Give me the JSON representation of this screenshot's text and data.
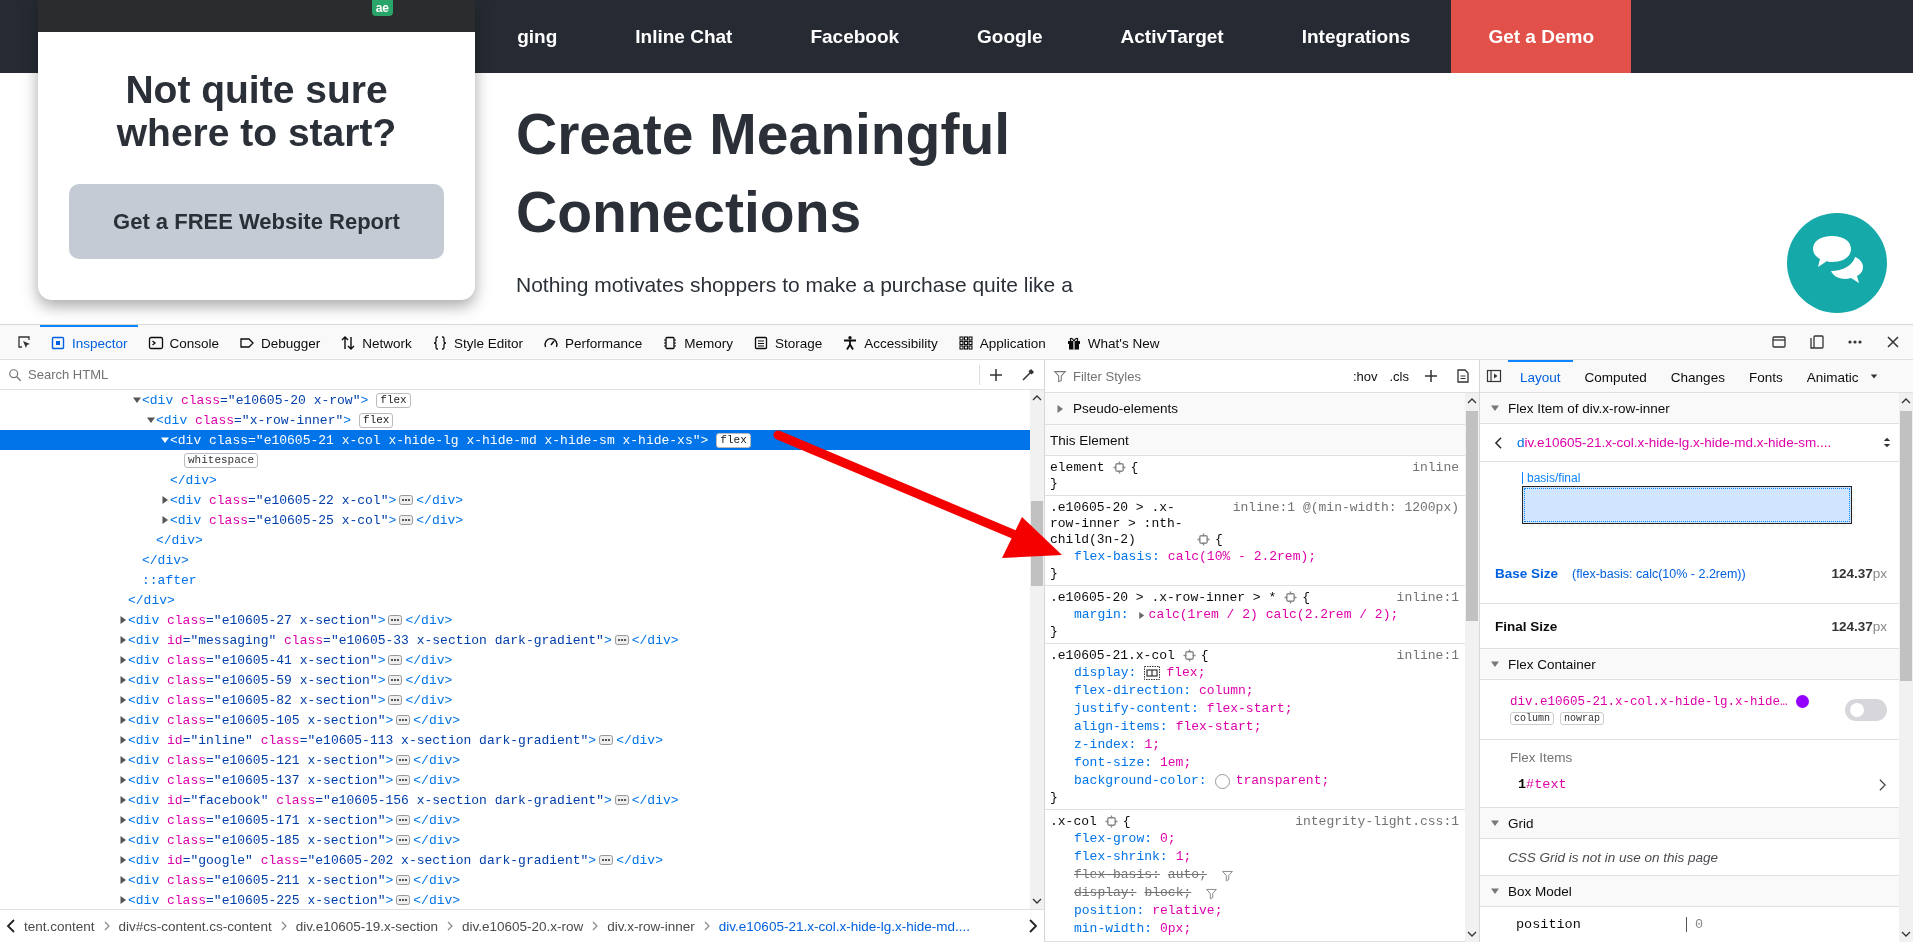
{
  "site": {
    "nav": [
      {
        "label": "ging"
      },
      {
        "label": "Inline Chat"
      },
      {
        "label": "Facebook"
      },
      {
        "label": "Google"
      },
      {
        "label": "ActivTarget"
      },
      {
        "label": "Integrations"
      }
    ],
    "demo_button": "Get a Demo",
    "popup": {
      "logo": "ae",
      "heading": "Not quite sure where to start?",
      "button": "Get a FREE Website Report"
    },
    "heading": "Create Meaningful Connections",
    "paragraph": "Nothing motivates shoppers to make a purchase quite like a"
  },
  "devtools": {
    "tabs": [
      {
        "label": "Inspector",
        "selected": true
      },
      {
        "label": "Console",
        "selected": false
      },
      {
        "label": "Debugger",
        "selected": false
      },
      {
        "label": "Network",
        "selected": false
      },
      {
        "label": "Style Editor",
        "selected": false
      },
      {
        "label": "Performance",
        "selected": false
      },
      {
        "label": "Memory",
        "selected": false
      },
      {
        "label": "Storage",
        "selected": false
      },
      {
        "label": "Accessibility",
        "selected": false
      },
      {
        "label": "Application",
        "selected": false
      },
      {
        "label": "What's New",
        "selected": false
      }
    ]
  },
  "inspector": {
    "search": {
      "placeholder": "Search HTML"
    },
    "tree": [
      {
        "kind": "element",
        "close": "</div>",
        "children": [
          {
            "kind": "element",
            "open": "<div class=\"e10605-20 x-row\">",
            "badge": "flex",
            "expanded": true,
            "selected": false,
            "close": "</div>",
            "children": [
              {
                "kind": "element",
                "open": "<div class=\"x-row-inner\">",
                "badge": "flex",
                "expanded": true,
                "selected": false,
                "close": "</div>",
                "children": [
                  {
                    "kind": "element",
                    "open": "<div class=\"e10605-21 x-col x-hide-lg x-hide-md x-hide-sm x-hide-xs\">",
                    "badge": "flex",
                    "expanded": true,
                    "selected": true,
                    "close": "</div>",
                    "children": [
                      {
                        "kind": "whitespace",
                        "badge": "whitespace"
                      }
                    ]
                  },
                  {
                    "kind": "element",
                    "open": "<div class=\"e10605-22 x-col\">",
                    "expanded": false,
                    "selected": false,
                    "close": "</div>"
                  },
                  {
                    "kind": "element",
                    "open": "<div class=\"e10605-25 x-col\">",
                    "expanded": false,
                    "selected": false,
                    "close": "</div>"
                  }
                ]
              }
            ]
          },
          {
            "kind": "pseudo",
            "open": "::after"
          }
        ]
      },
      {
        "kind": "element",
        "open": "<div class=\"e10605-27 x-section\">",
        "expanded": false,
        "selected": false,
        "close": "</div>"
      },
      {
        "kind": "element",
        "open": "<div id=\"messaging\" class=\"e10605-33 x-section dark-gradient\">",
        "expanded": false,
        "selected": false,
        "close": "</div>"
      },
      {
        "kind": "element",
        "open": "<div class=\"e10605-41 x-section\">",
        "expanded": false,
        "selected": false,
        "close": "</div>"
      },
      {
        "kind": "element",
        "open": "<div class=\"e10605-59 x-section\">",
        "expanded": false,
        "selected": false,
        "close": "</div>"
      },
      {
        "kind": "element",
        "open": "<div class=\"e10605-82 x-section\">",
        "expanded": false,
        "selected": false,
        "close": "</div>"
      },
      {
        "kind": "element",
        "open": "<div class=\"e10605-105 x-section\">",
        "expanded": false,
        "selected": false,
        "close": "</div>"
      },
      {
        "kind": "element",
        "open": "<div id=\"inline\" class=\"e10605-113 x-section dark-gradient\">",
        "expanded": false,
        "selected": false,
        "close": "</div>"
      },
      {
        "kind": "element",
        "open": "<div class=\"e10605-121 x-section\">",
        "expanded": false,
        "selected": false,
        "close": "</div>"
      },
      {
        "kind": "element",
        "open": "<div class=\"e10605-137 x-section\">",
        "expanded": false,
        "selected": false,
        "close": "</div>"
      },
      {
        "kind": "element",
        "open": "<div id=\"facebook\" class=\"e10605-156 x-section dark-gradient\">",
        "expanded": false,
        "selected": false,
        "close": "</div>"
      },
      {
        "kind": "element",
        "open": "<div class=\"e10605-171 x-section\">",
        "expanded": false,
        "selected": false,
        "close": "</div>"
      },
      {
        "kind": "element",
        "open": "<div class=\"e10605-185 x-section\">",
        "expanded": false,
        "selected": false,
        "close": "</div>"
      },
      {
        "kind": "element",
        "open": "<div id=\"google\" class=\"e10605-202 x-section dark-gradient\">",
        "expanded": false,
        "selected": false,
        "close": "</div>"
      },
      {
        "kind": "element",
        "open": "<div class=\"e10605-211 x-section\">",
        "expanded": false,
        "selected": false,
        "close": "</div>"
      },
      {
        "kind": "element",
        "open": "<div class=\"e10605-225 x-section\">",
        "expanded": false,
        "selected": false,
        "close": "</div>"
      }
    ],
    "breadcrumbs": [
      {
        "label": "tent.content",
        "selected": false
      },
      {
        "label": "div#cs-content.cs-content",
        "selected": false
      },
      {
        "label": "div.e10605-19.x-section",
        "selected": false
      },
      {
        "label": "div.e10605-20.x-row",
        "selected": false
      },
      {
        "label": "div.x-row-inner",
        "selected": false
      },
      {
        "label": "div.e10605-21.x-col.x-hide-lg.x-hide-md....",
        "selected": true
      }
    ]
  },
  "styles": {
    "filter": {
      "placeholder": "Filter Styles"
    },
    "hov": ":hov",
    "cls": ".cls",
    "pseudo": {
      "label": "Pseudo-elements",
      "expanded": false
    },
    "section": "This Element",
    "rules": [
      {
        "selector": "element",
        "source": "inline",
        "open": "{",
        "close": "}"
      },
      {
        "selector": ".e10605-20 > .x-row-inner > :nth-child(3n-2)",
        "source": "inline:1 @(min-width: 1200px)",
        "open": "{",
        "close": "}",
        "declarations": [
          {
            "property": "flex-basis:",
            "value": "calc(10% - 2.2rem);",
            "kind": "plain"
          }
        ]
      },
      {
        "selector": ".e10605-20 > .x-row-inner > *",
        "source": "inline:1",
        "open": "{",
        "close": "}",
        "declarations": [
          {
            "property": "margin:",
            "value": "calc(1rem / 2) calc(2.2rem / 2);",
            "kind": "shorthand"
          }
        ]
      },
      {
        "selector": ".e10605-21.x-col",
        "source": "inline:1",
        "open": "{",
        "close": "}",
        "declarations": [
          {
            "property": "display:",
            "value": "flex;",
            "kind": "display"
          },
          {
            "property": "flex-direction:",
            "value": "column;",
            "kind": "plain"
          },
          {
            "property": "justify-content:",
            "value": "flex-start;",
            "kind": "plain"
          },
          {
            "property": "align-items:",
            "value": "flex-start;",
            "kind": "plain"
          },
          {
            "property": "z-index:",
            "value": "1;",
            "kind": "plain"
          },
          {
            "property": "font-size:",
            "value": "1em;",
            "kind": "plain"
          },
          {
            "property": "background-color:",
            "value": "transparent;",
            "kind": "color"
          }
        ]
      },
      {
        "selector": ".x-col",
        "source": "integrity-light.css:1",
        "open": "{",
        "declarations": [
          {
            "property": "flex-grow:",
            "value": "0;",
            "kind": "plain"
          },
          {
            "property": "flex-shrink:",
            "value": "1;",
            "kind": "plain"
          },
          {
            "property": "flex-basis:",
            "value": "auto;",
            "kind": "overridden"
          },
          {
            "property": "display:",
            "value": "block;",
            "kind": "overridden"
          },
          {
            "property": "position:",
            "value": "relative;",
            "kind": "plain"
          },
          {
            "property": "min-width:",
            "value": "0px;",
            "kind": "plain"
          }
        ]
      }
    ]
  },
  "layout": {
    "tabs": [
      {
        "label": "Layout",
        "selected": true
      },
      {
        "label": "Computed",
        "selected": false
      },
      {
        "label": "Changes",
        "selected": false
      },
      {
        "label": "Fonts",
        "selected": false
      },
      {
        "label": "Animatic",
        "selected": false
      }
    ],
    "flex_item": {
      "title": "Flex Item of div.x-row-inner",
      "expanded": true,
      "selector": "div.e10605-21.x-col.x-hide-lg.x-hide-md.x-hide-sm....",
      "diagram_label": "basis/final",
      "sizes": [
        {
          "label": "Base Size",
          "note": "(flex-basis: calc(10% - 2.2rem))",
          "value": "124.37",
          "unit": "px"
        },
        {
          "label": "Final Size",
          "value": "124.37",
          "unit": "px"
        }
      ]
    },
    "flex_container": {
      "title": "Flex Container",
      "expanded": true,
      "selector": "div.e10605-21.x-col.x-hide-lg.x-hide…",
      "toggle_on": false,
      "tags": [
        "column",
        "nowrap"
      ],
      "items_title": "Flex Items",
      "items": [
        {
          "index": "1",
          "name": "#text"
        }
      ]
    },
    "grid": {
      "title": "Grid",
      "expanded": true,
      "message": "CSS Grid is not in use on this page"
    },
    "box_model": {
      "title": "Box Model",
      "expanded": true,
      "rows": [
        {
          "property": "position",
          "value": "0"
        }
      ]
    }
  }
}
